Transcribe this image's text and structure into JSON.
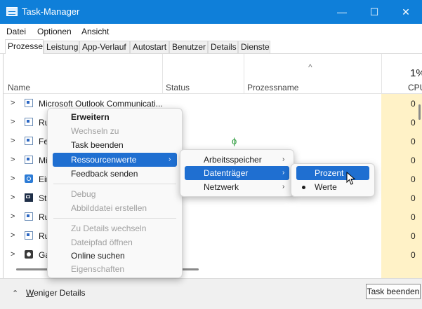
{
  "window": {
    "title": "Task-Manager",
    "controls": {
      "minimize": "—",
      "maximize": "☐",
      "close": "✕"
    }
  },
  "menubar": [
    "Datei",
    "Optionen",
    "Ansicht"
  ],
  "tabs": [
    {
      "label": "Prozesse",
      "active": true
    },
    {
      "label": "Leistung"
    },
    {
      "label": "App-Verlauf"
    },
    {
      "label": "Autostart"
    },
    {
      "label": "Benutzer"
    },
    {
      "label": "Details"
    },
    {
      "label": "Dienste"
    }
  ],
  "columns": {
    "name": "Name",
    "status": "Status",
    "prozessname": "Prozessname",
    "sort_arrow": "^",
    "cpu_percent": "1%",
    "cpu": "CPU"
  },
  "rows": [
    {
      "name": "Microsoft Outlook Communicati...",
      "icon": "window-icon",
      "cpu": "0"
    },
    {
      "name": "Ru",
      "icon": "window-icon",
      "cpu": "0"
    },
    {
      "name": "Fe",
      "icon": "window-icon",
      "cpu": "0"
    },
    {
      "name": "Mi",
      "icon": "window-icon",
      "cpu": "0"
    },
    {
      "name": "Ein",
      "icon": "settings-gear-icon",
      "cpu": "0"
    },
    {
      "name": "Sta",
      "icon": "terminal-icon",
      "cpu": "0"
    },
    {
      "name": "Ru",
      "icon": "window-icon",
      "cpu": "0"
    },
    {
      "name": "Ru",
      "icon": "window-icon",
      "cpu": "0"
    },
    {
      "name": "Ga",
      "icon": "xbox-icon",
      "cpu": "0"
    }
  ],
  "status_leaf": "ɸ",
  "context_menu": {
    "items": [
      {
        "label": "Erweitern",
        "bold": true
      },
      {
        "label": "Wechseln zu",
        "disabled": true
      },
      {
        "label": "Task beenden"
      },
      {
        "label": "Ressourcenwerte",
        "highlighted": true,
        "submenu": true
      },
      {
        "label": "Feedback senden"
      },
      {
        "label": "Debug",
        "disabled": true
      },
      {
        "label": "Abbilddatei erstellen",
        "disabled": true
      },
      {
        "label": "Zu Details wechseln",
        "disabled": true
      },
      {
        "label": "Dateipfad öffnen",
        "disabled": true
      },
      {
        "label": "Online suchen"
      },
      {
        "label": "Eigenschaften",
        "disabled": true
      }
    ]
  },
  "submenu_resources": {
    "items": [
      {
        "label": "Arbeitsspeicher"
      },
      {
        "label": "Datenträger",
        "highlighted": true
      },
      {
        "label": "Netzwerk"
      }
    ]
  },
  "submenu_disk": {
    "items": [
      {
        "label": "Prozent",
        "highlighted": true
      },
      {
        "label": "Werte",
        "checked": true
      }
    ]
  },
  "bottombar": {
    "less_details": "Weniger Details",
    "end_task": "Task beenden"
  },
  "colors": {
    "titlebar": "#0f7fd9",
    "highlight": "#1f6fd1",
    "cpu_column": "#fff2c7"
  }
}
